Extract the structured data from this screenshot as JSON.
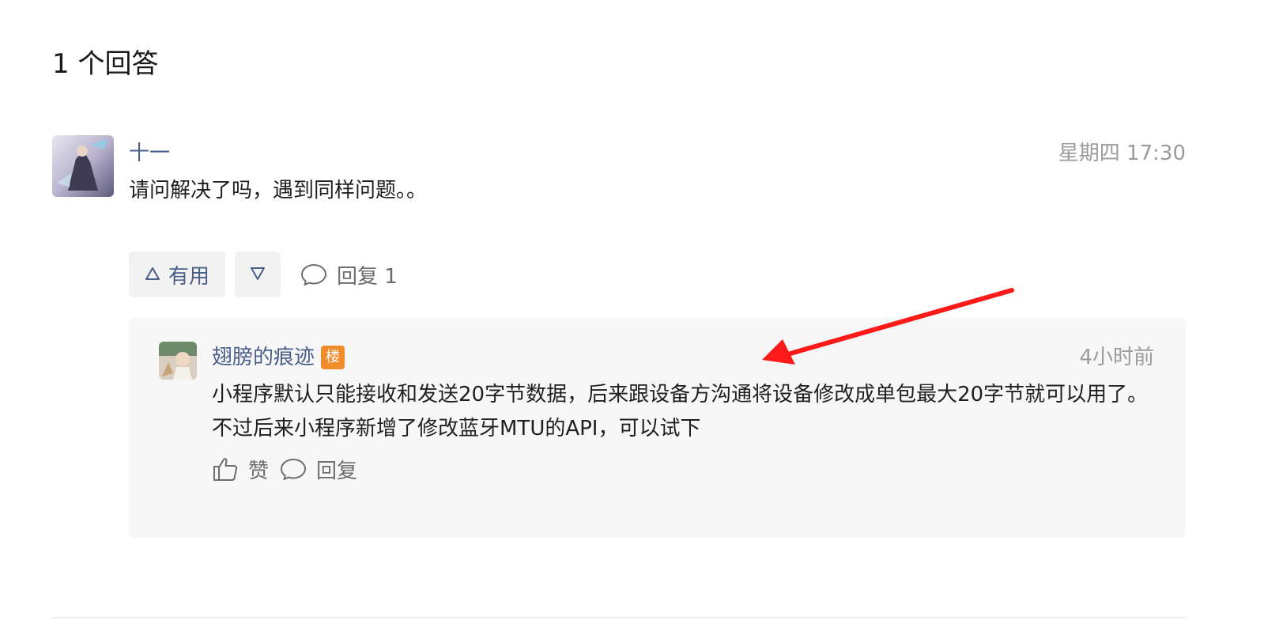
{
  "section": {
    "title": "1 个回答"
  },
  "answer": {
    "author": "十一",
    "timestamp": "星期四 17:30",
    "content": "请问解决了吗，遇到同样问题。。",
    "useful_label": "有用",
    "useful_icon": "triangle-up-icon",
    "down_icon": "triangle-down-icon",
    "reply_label": "回复 1",
    "reply_icon": "comment-icon"
  },
  "reply": {
    "author": "翅膀的痕迹",
    "badge": "楼",
    "badge_color": "#f08c2b",
    "timestamp": "4小时前",
    "content": "小程序默认只能接收和发送20字节数据，后来跟设备方沟通将设备修改成单包最大20字节就可以用了。不过后来小程序新增了修改蓝牙MTU的API，可以试下",
    "like_label": "赞",
    "like_icon": "thumbs-up-icon",
    "reply_label": "回复",
    "reply_icon": "comment-icon"
  },
  "colors": {
    "link": "#4a5e8a",
    "muted": "#9b9b9b",
    "annotation_arrow": "#ff1a1a"
  }
}
